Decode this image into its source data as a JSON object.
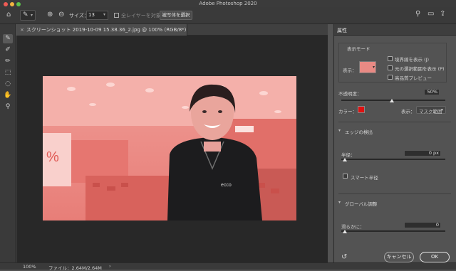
{
  "window": {
    "title": "Adobe Photoshop 2020"
  },
  "options_bar": {
    "size_label": "サイズ：",
    "size_value": "13",
    "sample_all_layers": "全レイヤーを対象",
    "select_subject": "被写体を選択"
  },
  "document": {
    "tab_title": "スクリーンショット 2019-10-09 15.38.36_2.jpg @ 100% (RGB/8*)"
  },
  "status": {
    "zoom": "100%",
    "file_info": "ファイル：2.64M/2.64M",
    "arrow": "›"
  },
  "properties": {
    "panel_title": "属性",
    "view_mode": {
      "heading": "表示モード",
      "view_label": "表示：",
      "show_edges": "境界線を表示 (J)",
      "show_original": "元の選択範囲を表示 (P)",
      "high_quality": "高品質プレビュー"
    },
    "opacity": {
      "label": "不透明度：",
      "value": "50%",
      "level": 0.5
    },
    "color_label": "カラー：",
    "color_value": "#e01010",
    "display_label": "表示：",
    "display_value": "マスク範囲",
    "edge_detection": {
      "heading": "エッジの検出",
      "radius_label": "半径：",
      "radius_value": "0 px",
      "smart_radius": "スマート半径"
    },
    "global_refinements": {
      "heading": "グローバル調整",
      "smooth_label": "滑らかに：",
      "smooth_value": "0"
    },
    "cancel": "キャンセル",
    "ok": "OK"
  }
}
